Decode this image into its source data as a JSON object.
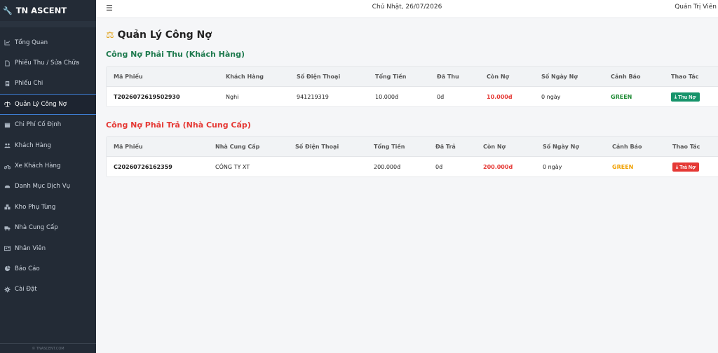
{
  "brand": {
    "name": "TN ASCENT"
  },
  "topbar": {
    "date": "Chủ Nhật, 26/07/2026",
    "user": "Quản Trị Viên"
  },
  "sidebar": {
    "items": [
      {
        "label": "Tổng Quan",
        "icon": "chart-line-icon"
      },
      {
        "label": "Phiếu Thu / Sửa Chữa",
        "icon": "file-icon"
      },
      {
        "label": "Phiếu Chi",
        "icon": "receipt-icon"
      },
      {
        "label": "Quản Lý Công Nợ",
        "icon": "scale-icon",
        "active": true
      },
      {
        "label": "Chi Phí Cố Định",
        "icon": "calendar-icon"
      },
      {
        "label": "Khách Hàng",
        "icon": "users-icon"
      },
      {
        "label": "Xe Khách Hàng",
        "icon": "motorbike-icon"
      },
      {
        "label": "Danh Mục Dịch Vụ",
        "icon": "car-icon"
      },
      {
        "label": "Kho Phụ Tùng",
        "icon": "boxes-icon"
      },
      {
        "label": "Nhà Cung Cấp",
        "icon": "truck-icon"
      },
      {
        "label": "Nhân Viên",
        "icon": "id-card-icon"
      },
      {
        "label": "Báo Cáo",
        "icon": "pie-chart-icon"
      },
      {
        "label": "Cài Đặt",
        "icon": "gear-icon"
      }
    ],
    "footer": "© TNASCENT.COM"
  },
  "page": {
    "title": "Quản Lý Công Nợ"
  },
  "receivable": {
    "title": "Công Nợ Phải Thu (Khách Hàng)",
    "headers": [
      "Mã Phiếu",
      "Khách Hàng",
      "Số Điện Thoại",
      "Tổng Tiền",
      "Đã Thu",
      "Còn Nợ",
      "Số Ngày Nợ",
      "Cảnh Báo",
      "Thao Tác"
    ],
    "rows": [
      {
        "code": "T2026072619502930",
        "name": "Nghi",
        "phone": "941219319",
        "total": "10.000đ",
        "paid": "0đ",
        "remaining": "10.000đ",
        "days": "0 ngày",
        "warning": "GREEN",
        "action": "Thu Nợ"
      }
    ]
  },
  "payable": {
    "title": "Công Nợ Phải Trả (Nhà Cung Cấp)",
    "headers": [
      "Mã Phiếu",
      "Nhà Cung Cấp",
      "Số Điện Thoại",
      "Tổng Tiền",
      "Đã Trả",
      "Còn Nợ",
      "Số Ngày Nợ",
      "Cảnh Báo",
      "Thao Tác"
    ],
    "rows": [
      {
        "code": "C20260726162359",
        "name": "CÔNG TY XT",
        "phone": "",
        "total": "200.000đ",
        "paid": "0đ",
        "remaining": "200.000đ",
        "days": "0 ngày",
        "warning": "GREEN",
        "action": "Trả Nợ"
      }
    ]
  },
  "colors": {
    "sidebar_bg": "#232b36",
    "accent_green": "#17946b",
    "accent_red": "#e53935",
    "warning_orange": "#f0a000"
  }
}
